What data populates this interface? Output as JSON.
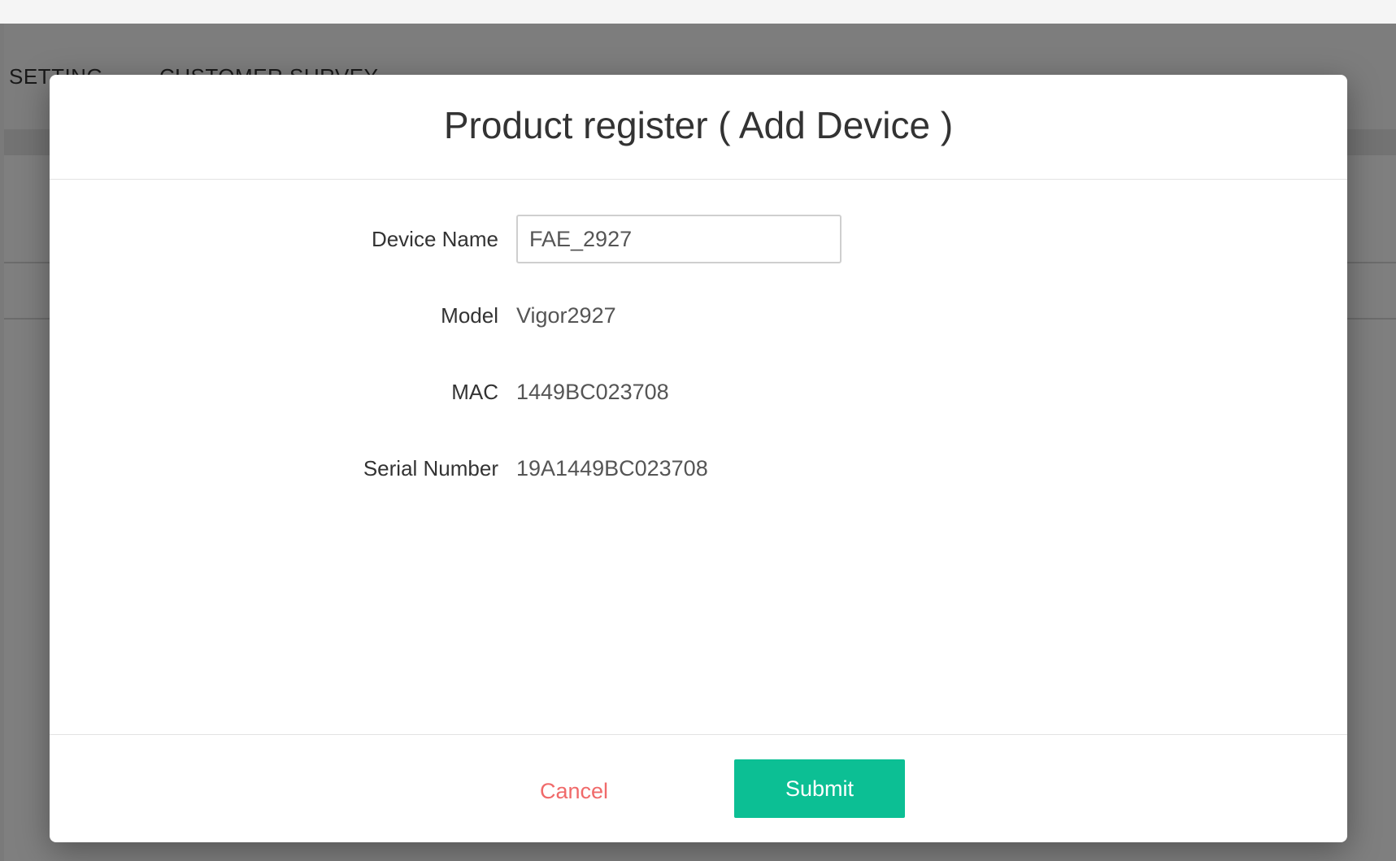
{
  "background": {
    "nav": {
      "setting_label": "SETTING",
      "survey_label": "CUSTOMER SURVEY"
    }
  },
  "modal": {
    "title": "Product register ( Add Device )",
    "fields": {
      "device_name": {
        "label": "Device Name",
        "value": "FAE_2927"
      },
      "model": {
        "label": "Model",
        "value": "Vigor2927"
      },
      "mac": {
        "label": "MAC",
        "value": "1449BC023708"
      },
      "serial": {
        "label": "Serial Number",
        "value": "19A1449BC023708"
      }
    },
    "footer": {
      "cancel_label": "Cancel",
      "submit_label": "Submit"
    }
  },
  "colors": {
    "submit": "#0cbf94",
    "cancel": "#f06a6a",
    "overlay": "rgba(0,0,0,0.5)"
  }
}
